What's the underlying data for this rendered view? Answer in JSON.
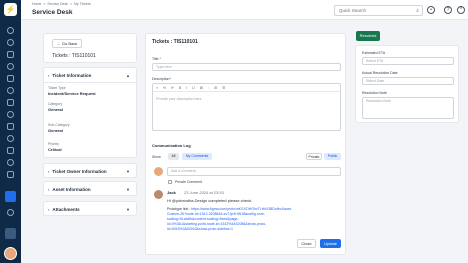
{
  "breadcrumb": [
    "Home",
    ">",
    "Service Desk",
    ">",
    "My Tickets"
  ],
  "page_title": "Service Desk",
  "search": {
    "placeholder": "Quick Search"
  },
  "left": {
    "go_back": "← Go Back",
    "ticket_label": "Tickets : TIS110101",
    "ticket_info": {
      "title": "Ticket Information",
      "fields": [
        {
          "label": "Ticket Type",
          "value": "Incident/Service Request"
        },
        {
          "label": "Category",
          "value": "General"
        },
        {
          "label": "Sub-Category",
          "value": "General"
        },
        {
          "label": "Priority",
          "value": "Critical"
        }
      ]
    },
    "owner_info": "Ticket Owner Information",
    "asset_info": "Asset Information",
    "attachments": "Attachments"
  },
  "main": {
    "title": "Tickets : TIS110101",
    "title_label": "Title *",
    "title_placeholder": "Type here",
    "desc_label": "Description*",
    "desc_placeholder": "Provide your description here",
    "comm_log": "Communication Log",
    "show_label": "Show",
    "filter_all": "All",
    "filter_mine": "My Comments",
    "private_btn": "Private",
    "public_btn": "Public",
    "comment_placeholder": "Add a comment...",
    "private_comment": "Private Comment",
    "entry": {
      "author": "Jack",
      "time": "23 June 2024 at 23:53",
      "text": "Hi @yohandha,Design completed please check.",
      "proto_label": "Prototype link :",
      "link_lines": [
        "https://www.figma.com/proto/wKGXOHGhvTLHkX38DuHu/Asset-",
        "Custom-26?node-id=1512-32086&t=zv7JpXHW1Bacal0g-nnre-",
        "scaling=fit-width&content-scaling=fixed&page-",
        "id=0%3A1&starting-point-node-id=1512%3A32086&show-proto-",
        "id=0015%3A00003&show-proto-sidebar=1"
      ]
    },
    "close_btn": "Close",
    "update_btn": "Update"
  },
  "right": {
    "status_btn": "Resolved",
    "eta_label": "Estimated ETA",
    "eta_placeholder": "Select ETA",
    "actual_label": "Actual Resolution Date",
    "actual_placeholder": "Select Date",
    "note_label": "Resolution Note",
    "note_placeholder": "Resolution Note"
  },
  "colors": {
    "sidebar": "#0e2a47",
    "primary": "#1f6feb",
    "resolved": "#17774e"
  }
}
